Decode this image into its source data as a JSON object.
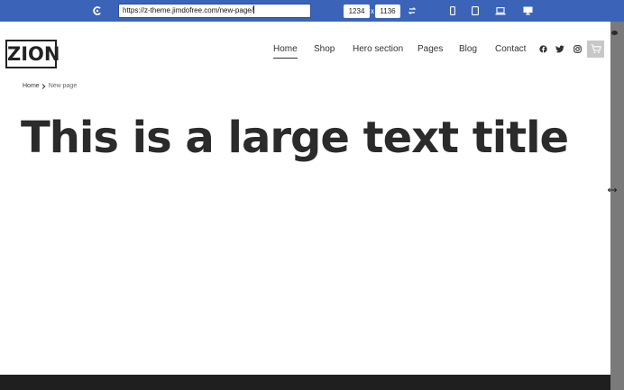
{
  "toolbar": {
    "url": "https://z-theme.jimdofree.com/new-page/",
    "width": "1234",
    "separator": "x",
    "height": "1136",
    "icons": [
      "logo-icon",
      "rotate-icon",
      "phone-icon",
      "tablet-icon",
      "laptop-icon",
      "desktop-icon"
    ],
    "bg_color": "#3b64b8"
  },
  "site": {
    "logo": "ZION",
    "nav": [
      {
        "label": "Home",
        "active": true
      },
      {
        "label": "Shop"
      },
      {
        "label": "Hero section"
      },
      {
        "label": "Pages"
      },
      {
        "label": "Blog"
      },
      {
        "label": "Contact"
      }
    ],
    "social_icons": [
      "facebook-icon",
      "twitter-icon",
      "instagram-icon"
    ],
    "cart_icon": "cart-icon"
  },
  "breadcrumb": {
    "home": "Home",
    "current": "New page"
  },
  "hero": {
    "title": "This is a large text title",
    "color": "#2b2b2b"
  },
  "footer": {
    "color": "#1f1f1f"
  }
}
